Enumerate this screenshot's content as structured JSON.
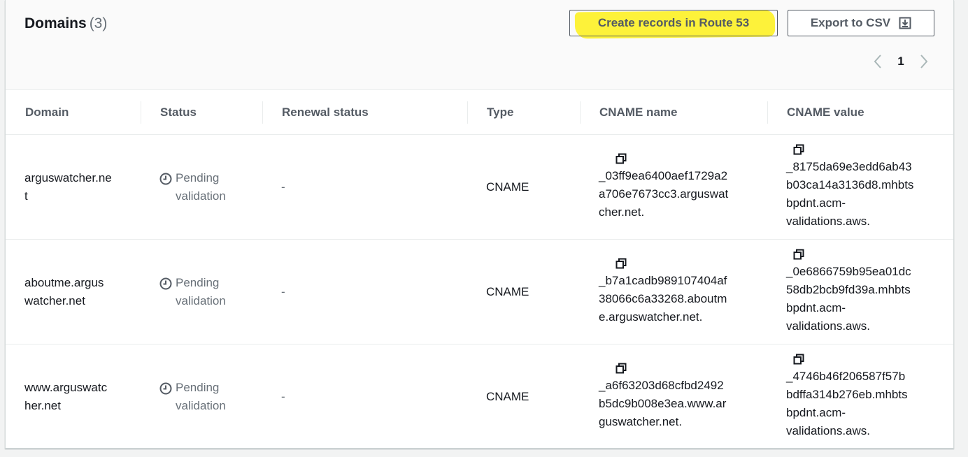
{
  "header": {
    "title": "Domains",
    "count": "(3)",
    "create_records_label": "Create records in Route 53",
    "export_label": "Export to CSV",
    "export_icon": "download-icon"
  },
  "pagination": {
    "prev_icon": "chevron-left-icon",
    "current_page": "1",
    "next_icon": "chevron-right-icon"
  },
  "columns": [
    "Domain",
    "Status",
    "Renewal status",
    "Type",
    "CNAME name",
    "CNAME value"
  ],
  "rows": [
    {
      "domain": "arguswatcher.ne\nt",
      "status": "Pending\nvalidation",
      "renewal_status": "-",
      "type": "CNAME",
      "cname_name": "_03ff9ea6400aef1729a2\na706e7673cc3.arguswat\ncher.net.",
      "cname_value": "_8175da69e3edd6ab43\nb03ca14a3136d8.mhbts\nbpdnt.acm-\nvalidations.aws."
    },
    {
      "domain": "aboutme.argus\nwatcher.net",
      "status": "Pending\nvalidation",
      "renewal_status": "-",
      "type": "CNAME",
      "cname_name": "_b7a1cadb989107404af\n38066c6a33268.aboutm\ne.arguswatcher.net.",
      "cname_value": "_0e6866759b95ea01dc\n58db2bcb9fd39a.mhbts\nbpdnt.acm-\nvalidations.aws."
    },
    {
      "domain": "www.arguswatc\nher.net",
      "status": "Pending\nvalidation",
      "renewal_status": "-",
      "type": "CNAME",
      "cname_name": "_a6f63203d68cfbd2492\nb5dc9b008e3ea.www.ar\nguswatcher.net.",
      "cname_value": "_4746b46f206587f57b\nbdffa314b276eb.mhbts\nbpdnt.acm-\nvalidations.aws."
    }
  ],
  "colors": {
    "highlight": "#fdf23a",
    "muted_text": "#687078",
    "button_text": "#545b64"
  }
}
